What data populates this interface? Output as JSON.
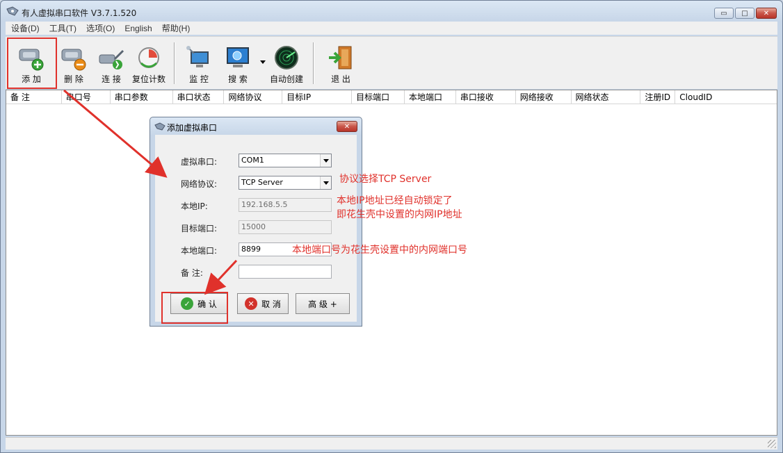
{
  "window": {
    "title": "有人虚拟串口软件 V3.7.1.520"
  },
  "window_buttons": {
    "minimize": "▭",
    "maximize": "□",
    "close": "✕"
  },
  "menu": [
    "设备(D)",
    "工具(T)",
    "选项(O)",
    "English",
    "帮助(H)"
  ],
  "toolbar": {
    "add": "添 加",
    "delete": "删 除",
    "connect": "连 接",
    "reset_count": "复位计数",
    "monitor": "监 控",
    "search": "搜 索",
    "auto_create": "自动创建",
    "exit": "退 出"
  },
  "columns": [
    "备 注",
    "串口号",
    "串口参数",
    "串口状态",
    "网络协议",
    "目标IP",
    "目标端口",
    "本地端口",
    "串口接收",
    "网络接收",
    "网络状态",
    "注册ID",
    "CloudID"
  ],
  "dialog": {
    "title": "添加虚拟串口",
    "virtual_com_label": "虚拟串口:",
    "virtual_com_value": "COM1",
    "protocol_label": "网络协议:",
    "protocol_value": "TCP Server",
    "local_ip_label": "本地IP:",
    "local_ip_value": "192.168.5.5",
    "target_port_label": "目标端口:",
    "target_port_value": "15000",
    "local_port_label": "本地端口:",
    "local_port_value": "8899",
    "remark_label": "备 注:",
    "remark_value": "",
    "ok_label": "确 认",
    "cancel_label": "取 消",
    "advanced_label": "高 级 +"
  },
  "annotations": {
    "protocol_note": "协议选择TCP Server",
    "ip_note_line1": "本地IP地址已经自动锁定了",
    "ip_note_line2": "即花生壳中设置的内网IP地址",
    "port_note": "本地端口号为花生壳设置中的内网端口号"
  },
  "colors": {
    "annotation": "#e0312b",
    "ok_icon": "#3aa43a",
    "cancel_icon": "#d2322b"
  }
}
